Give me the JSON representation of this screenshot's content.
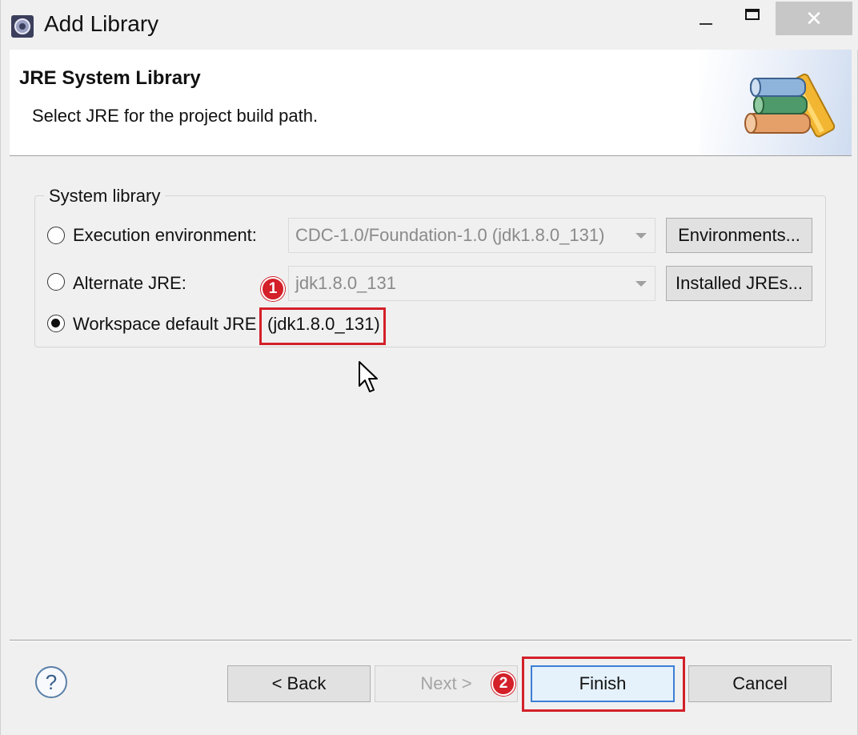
{
  "window": {
    "title": "Add Library",
    "close_glyph": "✕"
  },
  "banner": {
    "title": "JRE System Library",
    "subtitle": "Select JRE for the project build path.",
    "icon": "library-books-icon"
  },
  "system_library": {
    "group_label": "System library",
    "options": [
      {
        "label": "Execution environment:",
        "selected": false,
        "combo_value": "CDC-1.0/Foundation-1.0 (jdk1.8.0_131)",
        "button": "Environments..."
      },
      {
        "label": "Alternate JRE:",
        "selected": false,
        "combo_value": "jdk1.8.0_131",
        "button": "Installed JREs..."
      },
      {
        "label": "Workspace default JRE",
        "selected": true,
        "value": "(jdk1.8.0_131)"
      }
    ]
  },
  "annotations": {
    "callout_1": "1",
    "callout_2": "2",
    "highlight_color": "#d32029"
  },
  "footer": {
    "help_glyph": "?",
    "back_label": "< Back",
    "next_label": "Next >",
    "finish_label": "Finish",
    "cancel_label": "Cancel"
  }
}
